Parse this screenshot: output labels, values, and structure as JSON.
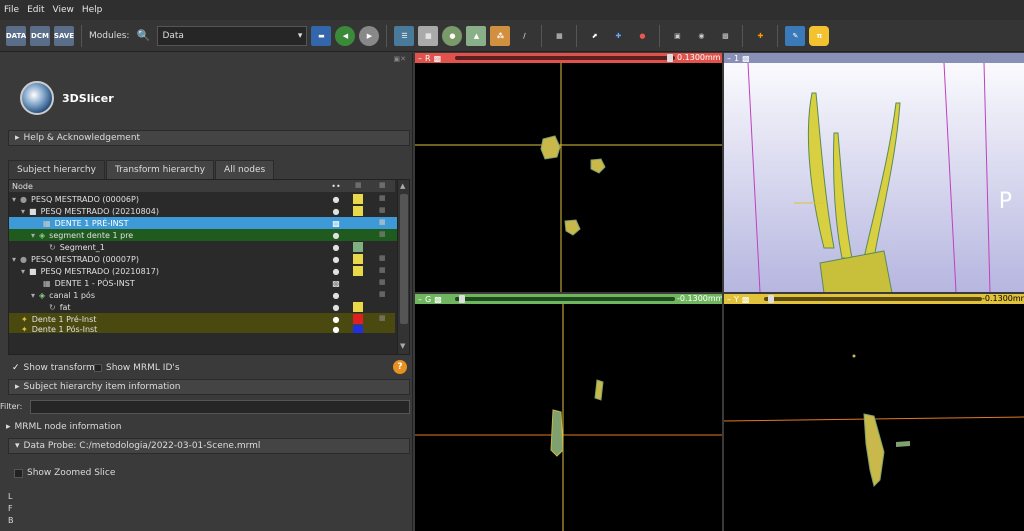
{
  "menu": [
    "File",
    "Edit",
    "View",
    "Help"
  ],
  "toolbar": {
    "btn1": "DATA",
    "btn2": "DCM",
    "btn3": "SAVE",
    "modules_label": "Modules:",
    "module_selected": "Data"
  },
  "app": {
    "name": "3DSlicer"
  },
  "sections": {
    "help": "Help & Acknowledgement",
    "sh_info": "Subject hierarchy item information",
    "mrml": "MRML node information",
    "probe": "Data Probe: C:/metodologia/2022-03-01-Scene.mrml"
  },
  "tabs": [
    "Subject hierarchy",
    "Transform hierarchy",
    "All nodes"
  ],
  "tree": {
    "header": "Node",
    "rows": [
      {
        "label": "PESQ MESTRADO (00006P)",
        "color": "#e8d84a"
      },
      {
        "label": "PESQ MESTRADO (20210804)",
        "color": "#e8d84a"
      },
      {
        "label": "DENTE 1 PRÉ-INST",
        "color": ""
      },
      {
        "label": "segment dente 1 pre",
        "color": ""
      },
      {
        "label": "Segment_1",
        "color": "#7fb07f"
      },
      {
        "label": "PESQ MESTRADO (00007P)",
        "color": "#e8d84a"
      },
      {
        "label": "PESQ MESTRADO (20210817)",
        "color": "#e8d84a"
      },
      {
        "label": "DENTE 1 - PÓS-INST",
        "color": ""
      },
      {
        "label": "canal 1 pós",
        "color": ""
      },
      {
        "label": "fat",
        "color": "#e8d84a"
      },
      {
        "label": "Dente 1 Pré-Inst",
        "color": "#e02020"
      },
      {
        "label": "Dente 1 Pós-Inst",
        "color": "#2030e0"
      }
    ]
  },
  "options": {
    "show_transforms": "Show transforms",
    "show_ids": "Show MRML ID's"
  },
  "filter": {
    "label": "Filter:"
  },
  "probe": {
    "zoom": "Show Zoomed Slice",
    "l": "L",
    "f": "F",
    "b": "B"
  },
  "views": {
    "red": {
      "name": "R",
      "value": "0.1300mm",
      "color": "#e0524b"
    },
    "three": {
      "name": "1",
      "label": "P"
    },
    "green": {
      "name": "G",
      "value": "-0.1300mm",
      "color": "#6fb65f"
    },
    "yellow": {
      "name": "Y",
      "value": "-0.1300mm",
      "color": "#e0c23c"
    }
  }
}
